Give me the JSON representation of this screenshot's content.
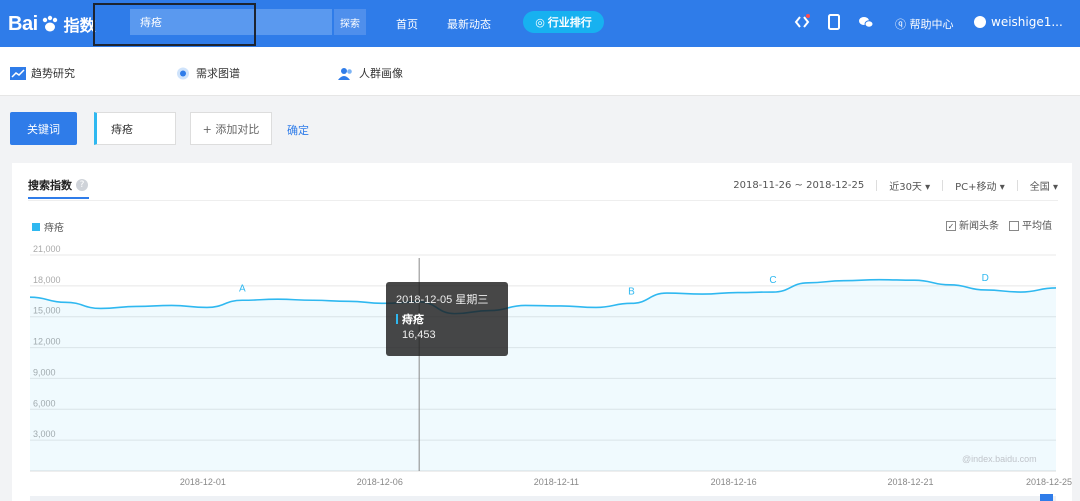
{
  "header": {
    "logo_text": "Bai",
    "logo_suffix": "指数",
    "search_value": "痔疮",
    "search_button": "探索",
    "nav": [
      "首页",
      "最新动态"
    ],
    "industry_label": "行业排行",
    "help_label": "帮助中心",
    "user_name": "weishige1..."
  },
  "subnav": {
    "items": [
      "趋势研究",
      "需求图谱",
      "人群画像"
    ]
  },
  "keywords": {
    "keyword_button": "关键词",
    "keyword": "痔疮",
    "add_compare": "+ 添加对比",
    "confirm": "确定"
  },
  "panel": {
    "title": "搜索指数",
    "date_range": "2018-11-26 ~ 2018-12-25",
    "period": "近30天",
    "device": "PC+移动",
    "region": "全国",
    "legend": "痔疮",
    "check_news": "新闻头条",
    "check_avg": "平均值",
    "watermark": "@index.baidu.com"
  },
  "tooltip": {
    "date": "2018-12-05 星期三",
    "series": "痔疮",
    "value": "16,453"
  },
  "chart_data": {
    "type": "area",
    "series": [
      {
        "name": "痔疮",
        "color": "#2fb8f0",
        "values": [
          16900,
          16400,
          15800,
          16000,
          16100,
          15900,
          16600,
          16700,
          16600,
          16500,
          16300,
          16453,
          15300,
          15600,
          16100,
          16050,
          15900,
          16300,
          17300,
          17200,
          17350,
          17400,
          18300,
          18500,
          18600,
          18550,
          18100,
          17600,
          17400,
          17800
        ]
      }
    ],
    "y_ticks": [
      "21,000",
      "18,000",
      "15,000",
      "12,000",
      "9,000",
      "6,000",
      "3,000"
    ],
    "x_ticks": [
      "2018-12-01",
      "2018-12-06",
      "2018-12-11",
      "2018-12-16",
      "2018-12-21",
      "2018-12-25"
    ],
    "x_tick_index": [
      5,
      10,
      15,
      20,
      25,
      29
    ],
    "ylim": [
      0,
      21000
    ],
    "annotations": [
      {
        "label": "A",
        "index": 6
      },
      {
        "label": "B",
        "index": 17
      },
      {
        "label": "C",
        "index": 21
      },
      {
        "label": "D",
        "index": 27
      }
    ],
    "cursor_index": 11
  }
}
